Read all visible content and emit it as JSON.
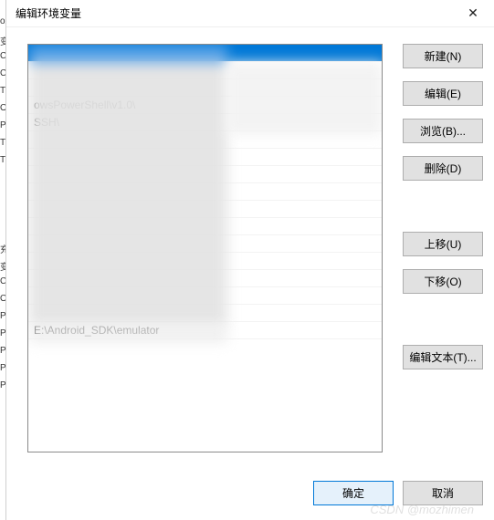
{
  "window": {
    "title": "编辑环境变量",
    "close_glyph": "✕"
  },
  "list": {
    "rows": [
      "",
      "",
      "",
      "                                              owsPowerShell\\v1.0\\",
      "                                              SSH\\",
      "",
      "",
      "",
      "",
      "",
      "",
      "",
      "",
      "",
      "",
      "",
      "E:\\Android_SDK\\emulator"
    ],
    "selected_index": 0
  },
  "buttons": {
    "new": "新建(N)",
    "edit": "编辑(E)",
    "browse": "浏览(B)...",
    "delete": "删除(D)",
    "moveup": "上移(U)",
    "movedown": "下移(O)",
    "edittext": "编辑文本(T)...",
    "ok": "确定",
    "cancel": "取消"
  },
  "left_strip": [
    "oz",
    "变",
    "CI",
    "CI",
    "TI",
    "O",
    "Pa",
    "TE",
    "TI",
    "",
    "",
    "",
    "",
    "充",
    "变",
    "CI",
    "O",
    "Pa",
    "PA",
    "PF",
    "PF",
    "PF"
  ],
  "watermark": "CSDN @mozhimen"
}
